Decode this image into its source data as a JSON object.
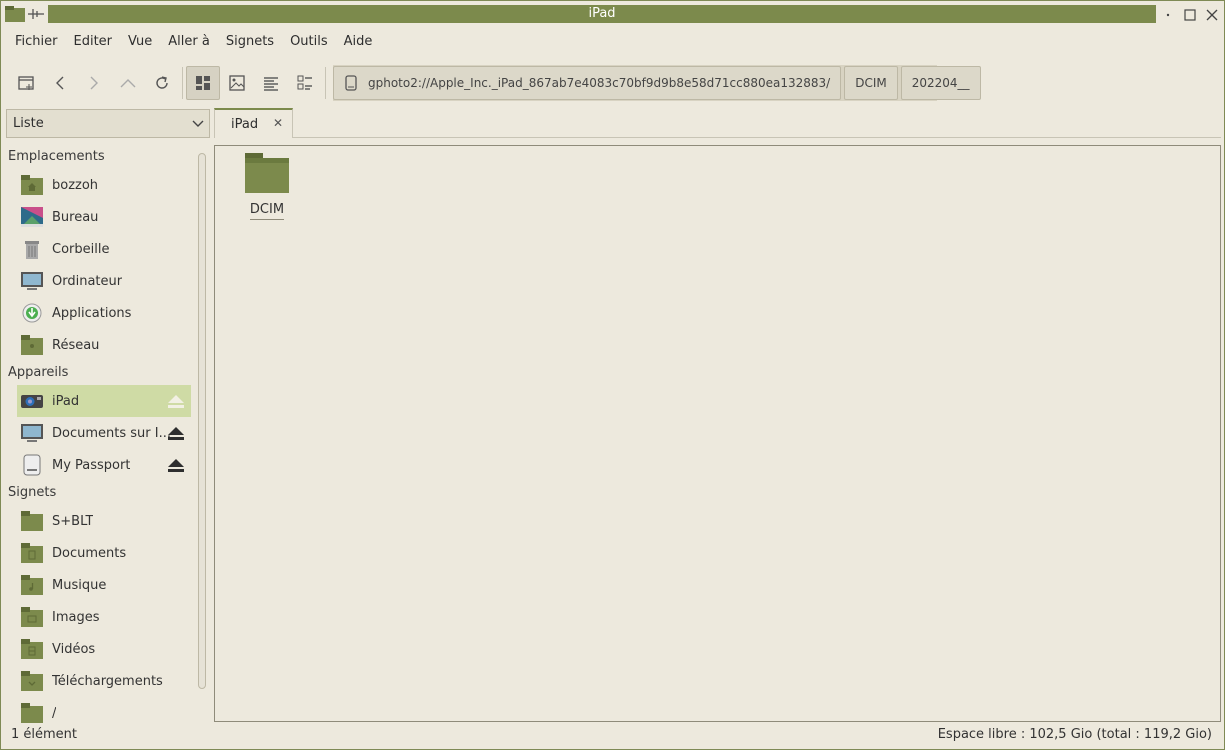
{
  "window": {
    "title": "iPad"
  },
  "menu": [
    "Fichier",
    "Editer",
    "Vue",
    "Aller à",
    "Signets",
    "Outils",
    "Aide"
  ],
  "pathbar": {
    "segments": [
      "gphoto2://Apple_Inc._iPad_867ab7e4083c70bf9d9b8e58d71cc880ea132883/",
      "DCIM",
      "202204__"
    ]
  },
  "view_select": {
    "value": "Liste"
  },
  "sidebar": {
    "sections": {
      "places": "Emplacements",
      "devices": "Appareils",
      "bookmarks": "Signets"
    },
    "places": [
      "bozzoh",
      "Bureau",
      "Corbeille",
      "Ordinateur",
      "Applications",
      "Réseau"
    ],
    "devices": [
      "iPad",
      "Documents sur I...",
      "My Passport"
    ],
    "bookmarks": [
      "S+BLT",
      "Documents",
      "Musique",
      "Images",
      "Vidéos",
      "Téléchargements",
      "/"
    ]
  },
  "tab": {
    "label": "iPad"
  },
  "files": [
    {
      "name": "DCIM",
      "icon": "folder-icon"
    }
  ],
  "status": {
    "count": "1 élément",
    "free_space": "Espace libre : 102,5 Gio (total : 119,2 Gio)"
  },
  "colors": {
    "accent": "#7c8a4c",
    "selected": "#cfdba5",
    "background": "#ede9dd"
  }
}
